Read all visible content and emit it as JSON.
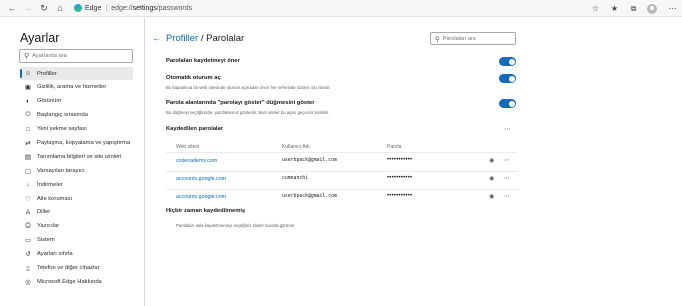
{
  "browser": {
    "app_name": "Edge",
    "url_prefix": "edge://",
    "url_bold": "settings",
    "url_suffix": "/passwords"
  },
  "sidebar": {
    "title": "Ayarlar",
    "search_placeholder": "Ayarlarda ara",
    "items": [
      {
        "label": "Profiller",
        "icon": "person-icon",
        "active": true
      },
      {
        "label": "Gizlilik, arama ve hizmetler",
        "icon": "lock-icon"
      },
      {
        "label": "Görünüm",
        "icon": "appearance-icon"
      },
      {
        "label": "Başlangıç sırasında",
        "icon": "power-icon"
      },
      {
        "label": "Yeni sekme sayfası",
        "icon": "new-tab-icon"
      },
      {
        "label": "Paylaşma, kopyalama ve yapıştırma",
        "icon": "share-icon"
      },
      {
        "label": "Tanımlama bilgileri ve site izinleri",
        "icon": "site-permissions-icon"
      },
      {
        "label": "Varsayılan tarayıcı",
        "icon": "browser-icon"
      },
      {
        "label": "İndirmeler",
        "icon": "download-icon"
      },
      {
        "label": "Aile koruması",
        "icon": "family-icon"
      },
      {
        "label": "Diller",
        "icon": "language-icon"
      },
      {
        "label": "Yazıcılar",
        "icon": "printer-icon"
      },
      {
        "label": "Sistem",
        "icon": "system-icon"
      },
      {
        "label": "Ayarları sıfırla",
        "icon": "reset-icon"
      },
      {
        "label": "Telefon ve diğer cihazlar",
        "icon": "phone-icon"
      },
      {
        "label": "Microsoft Edge Hakkında",
        "icon": "edge-icon"
      }
    ]
  },
  "main": {
    "breadcrumb_link": "Profiller",
    "breadcrumb_sep": " / ",
    "page_title": "Parolalar",
    "search_placeholder": "Parolaları ara",
    "settings": [
      {
        "title": "Parolaları kaydetmeyi öner",
        "desc": "",
        "enabled": true
      },
      {
        "title": "Otomatik oturum aç",
        "desc": "Bu kapatılırsa bir web sitesinde oturum açmadan önce her seferinde sizden izin istenir.",
        "enabled": true
      },
      {
        "title": "Parola alanlarında \"parolayı göster\" düğmesini göster",
        "desc": "Bu düğmeyi seçtiğinizde, yazdıklarınız gösterilir. Bazı siteler bu ayarı geçersiz kılabilir.",
        "enabled": true
      }
    ],
    "saved_title": "Kaydedilen parolalar",
    "columns": {
      "site": "Web sitesi",
      "user": "Kullanıcı Adı",
      "password": "Parola"
    },
    "passwords": [
      {
        "site": "codecademy.com",
        "user": "userbpack@gmail.com",
        "password": "•••••••••••"
      },
      {
        "site": "accounts.google.com",
        "user": "cumnanchi",
        "password": "•••••••••••"
      },
      {
        "site": "accounts.google.com",
        "user": "userbpack@gmail.com",
        "password": "•••••••••••"
      }
    ],
    "never_title": "Hiçbir zaman kaydedilmemiş",
    "never_desc": "Parolaları asla kaydetmemeyi seçtiğiniz siteler burada görünür"
  },
  "colors": {
    "accent": "#0f6cbd"
  }
}
